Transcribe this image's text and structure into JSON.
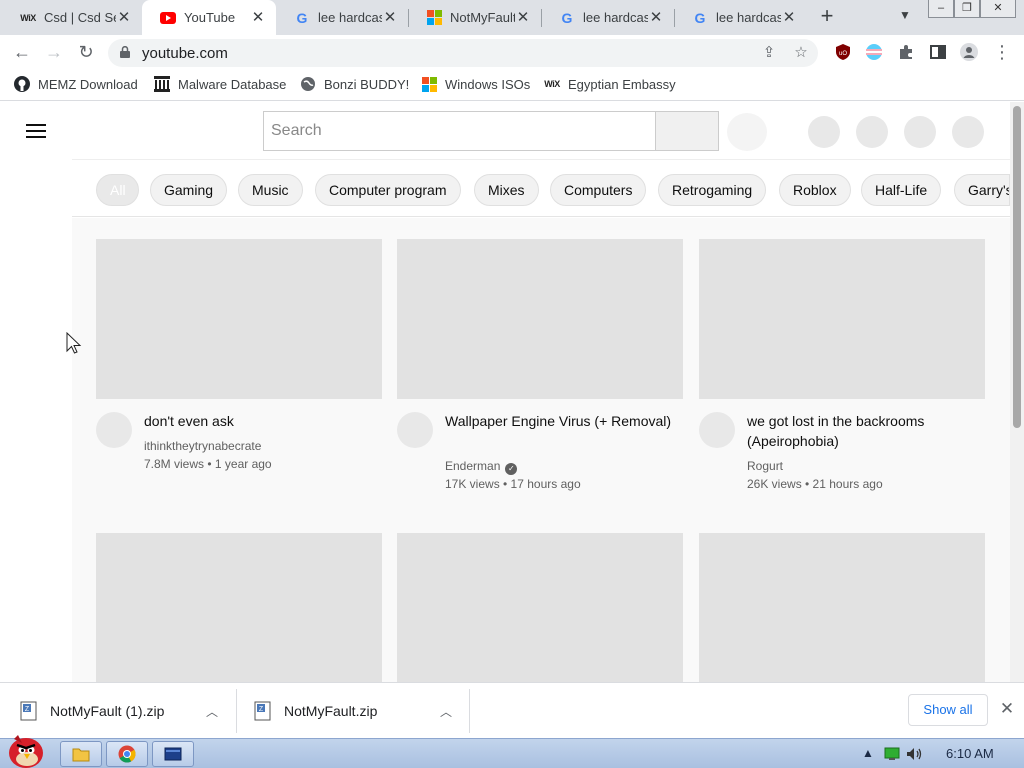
{
  "browser": {
    "tabs": [
      {
        "title": "Csd | Csd Se",
        "icon": "wix-icon",
        "active": false
      },
      {
        "title": "YouTube",
        "icon": "youtube-icon",
        "active": true
      },
      {
        "title": "lee hardcas",
        "icon": "google-icon",
        "active": false
      },
      {
        "title": "NotMyFault",
        "icon": "microsoft-icon",
        "active": false
      },
      {
        "title": "lee hardcas",
        "icon": "google-icon",
        "active": false
      },
      {
        "title": "lee hardcas",
        "icon": "google-icon",
        "active": false
      }
    ],
    "new_tab": "+",
    "window_controls": {
      "minimize": "–",
      "restore": "❐",
      "close": "✕"
    },
    "url": "youtube.com",
    "bookmarks": [
      {
        "label": "MEMZ Download",
        "icon": "github-icon"
      },
      {
        "label": "Malware Database",
        "icon": "library-icon"
      },
      {
        "label": "Bonzi BUDDY!",
        "icon": "globe-icon"
      },
      {
        "label": "Windows ISOs",
        "icon": "microsoft-icon"
      },
      {
        "label": "Egyptian Embassy",
        "icon": "wix-icon"
      }
    ]
  },
  "youtube": {
    "search_placeholder": "Search",
    "chips": [
      "All",
      "Gaming",
      "Music",
      "Computer program",
      "Mixes",
      "Computers",
      "Retrogaming",
      "Roblox",
      "Half-Life",
      "Garry's"
    ],
    "videos": [
      {
        "title": "don't even ask",
        "channel": "ithinktheytrynabecrate",
        "meta": "7.8M views • 1 year ago",
        "verified": false
      },
      {
        "title": "Wallpaper Engine Virus (+ Removal)",
        "channel": "Enderman",
        "meta": "17K views • 17 hours ago",
        "verified": true
      },
      {
        "title": "we got lost in the backrooms (Apeirophobia)",
        "channel": "Rogurt",
        "meta": "26K views • 21 hours ago",
        "verified": false
      }
    ]
  },
  "downloads": {
    "items": [
      "NotMyFault (1).zip",
      "NotMyFault.zip"
    ],
    "show_all": "Show all"
  },
  "taskbar": {
    "clock": "6:10 AM"
  },
  "colors": {
    "accent_blue": "#1a73e8",
    "youtube_red": "#ff0000"
  }
}
